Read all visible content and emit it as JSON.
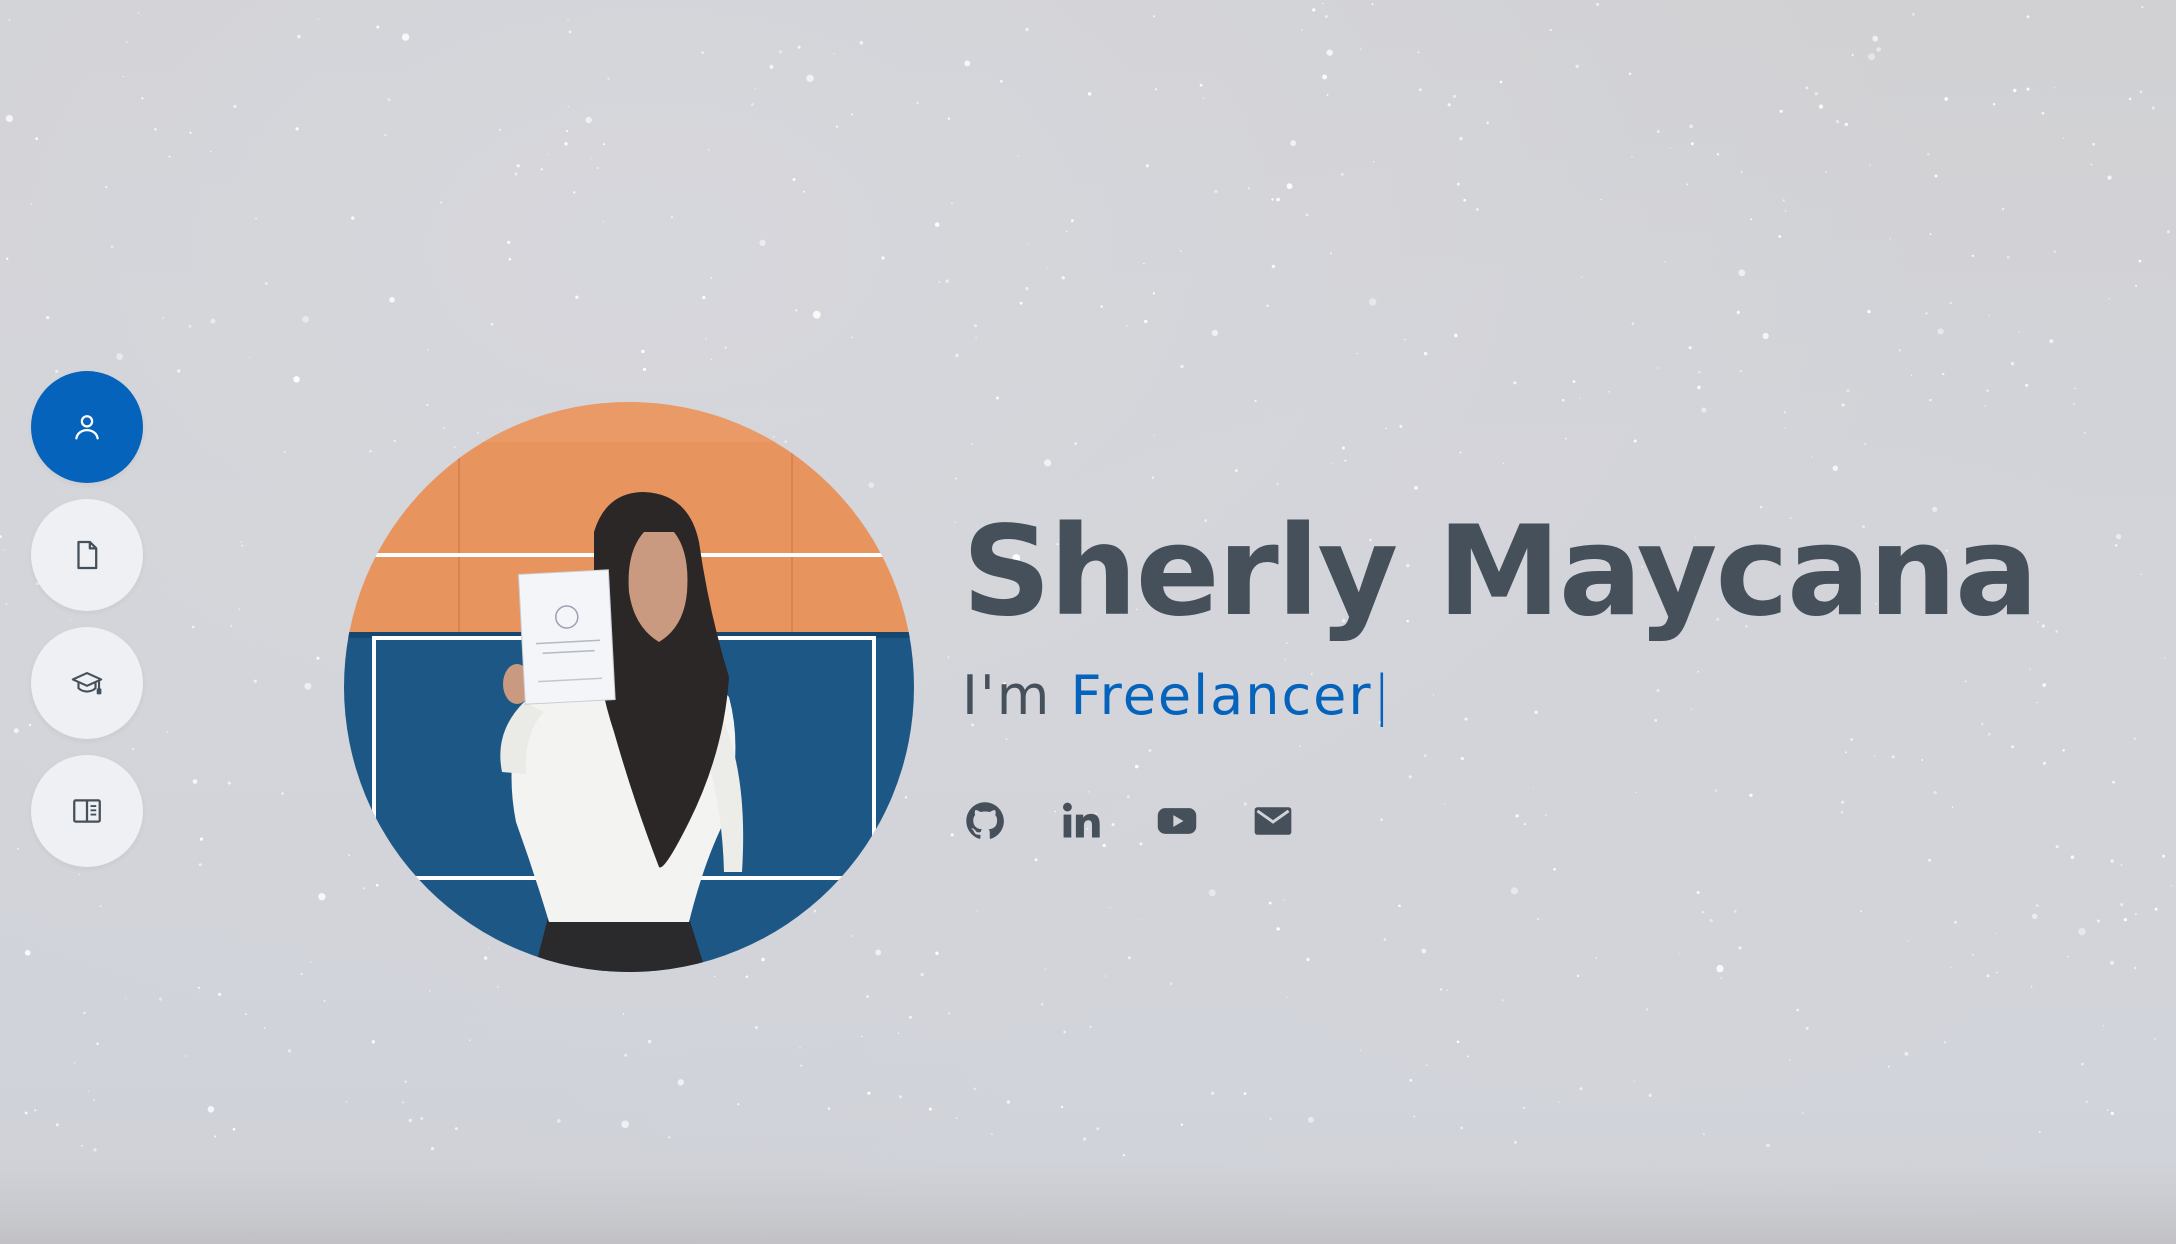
{
  "colors": {
    "accent": "#0563bb",
    "text": "#45505b",
    "nav_bg": "#eef0f3",
    "background": "#d2d3d8"
  },
  "nav": [
    {
      "icon": "person-icon",
      "active": true
    },
    {
      "icon": "file-icon",
      "active": false
    },
    {
      "icon": "graduation-cap-icon",
      "active": false
    },
    {
      "icon": "book-icon",
      "active": false
    }
  ],
  "hero": {
    "name": "Sherly Maycana",
    "prefix": "I'm ",
    "role": "Freelancer",
    "cursor": "|"
  },
  "avatar": {
    "icon": "profile-photo"
  },
  "socials": [
    {
      "icon": "github-icon"
    },
    {
      "icon": "linkedin-icon"
    },
    {
      "icon": "youtube-icon"
    },
    {
      "icon": "mail-icon"
    }
  ]
}
